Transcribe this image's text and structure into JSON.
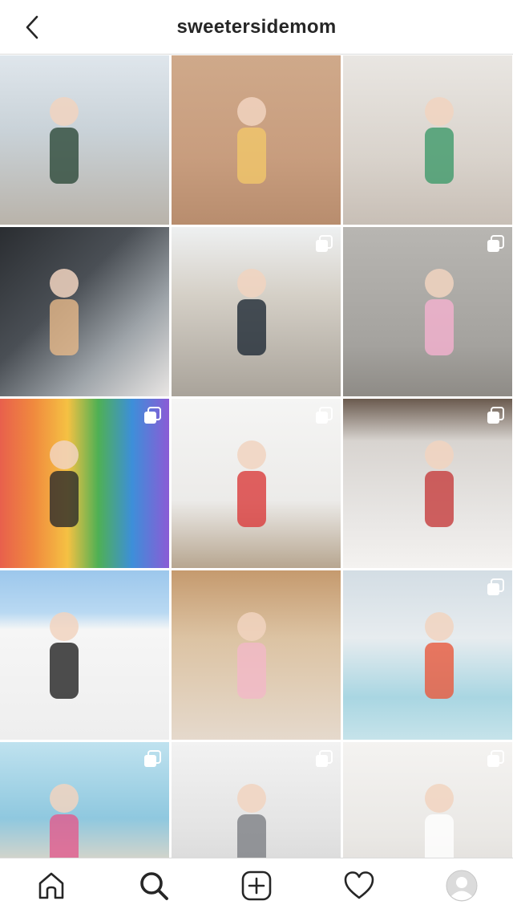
{
  "header": {
    "username": "sweetersidemom"
  },
  "posts": [
    {
      "multi": false,
      "bg": "linear-gradient(180deg,#dfe6ec 0%,#c9d2d8 45%,#b9b3aa 100%)",
      "accent": "#2d4a3a"
    },
    {
      "multi": false,
      "bg": "linear-gradient(180deg,#cfa98a 0%,#c89d7e 60%,#b88d6e 100%)",
      "accent": "#f1c76a"
    },
    {
      "multi": false,
      "bg": "linear-gradient(180deg,#e9e6e2 0%,#d9d3cc 60%,#c8bfb6 100%)",
      "accent": "#3f9a6a"
    },
    {
      "multi": false,
      "bg": "linear-gradient(135deg,#2a2d31 0%,#4a4f55 40%,#9ea4a9 70%,#e9e6e4 100%)",
      "accent": "#e7b98a"
    },
    {
      "multi": true,
      "bg": "linear-gradient(180deg,#eef0f1 0%,#d5d0c7 40%,#a9a39a 100%)",
      "accent": "#1f2a36"
    },
    {
      "multi": true,
      "bg": "linear-gradient(180deg,#b8b6b2 0%,#a4a29e 70%,#8e8b86 100%)",
      "accent": "#f5b1d0"
    },
    {
      "multi": true,
      "bg": "linear-gradient(90deg,#e8604c 0%,#f08a3e 20%,#f5c143 40%,#4fb054 58%,#3d8fd9 78%,#8b5bd6 100%)",
      "accent": "#2a2a2a"
    },
    {
      "multi": true,
      "bg": "linear-gradient(180deg,#f5f5f4 0%,#ecebe9 60%,#b7a690 100%)",
      "accent": "#d93b3b"
    },
    {
      "multi": true,
      "bg": "linear-gradient(180deg,#6a5a4e 0%,#d8d4d0 25%,#e8e6e4 70%,#f4f2f0 100%)",
      "accent": "#c63c3c"
    },
    {
      "multi": false,
      "bg": "linear-gradient(180deg,#9cc7ec 0%,#b9d9f2 25%,#f6f6f6 35%,#eeeeee 100%)",
      "accent": "#222222"
    },
    {
      "multi": false,
      "bg": "linear-gradient(180deg,#c59a6e 0%,#dcc3a3 40%,#e5d9cc 100%)",
      "accent": "#f3b8c8"
    },
    {
      "multi": true,
      "bg": "linear-gradient(180deg,#d3dde4 0%,#e7ecef 40%,#a9d6e2 75%,#c6e3ea 100%)",
      "accent": "#e8593c"
    },
    {
      "multi": true,
      "bg": "linear-gradient(180deg,#bfe2ef 0%,#8fc8df 45%,#e3d7c6 75%,#f0e8de 100%)",
      "accent": "#e25a8c"
    },
    {
      "multi": true,
      "bg": "linear-gradient(180deg,#f2f2f2 0%,#e4e4e4 50%,#cfcfcf 100%)",
      "accent": "#7d7f84"
    },
    {
      "multi": true,
      "bg": "linear-gradient(180deg,#f4f3f1 0%,#eae8e5 55%,#d9d6d2 100%)",
      "accent": "#ffffff"
    }
  ],
  "nav": {
    "items": [
      "home",
      "search",
      "new-post",
      "activity",
      "profile"
    ]
  }
}
